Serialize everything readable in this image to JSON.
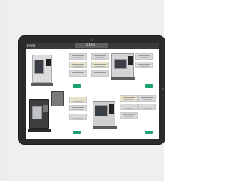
{
  "app": {
    "brand": "HAAS",
    "title": "DEMO"
  },
  "colors": {
    "page_background": "#efefef",
    "tablet_bezel": "#2b2b2b",
    "screen_background": "#ffffff",
    "header_bar": "#3a3a3a",
    "action_button": "#1aa36e"
  },
  "cards": [
    {
      "position": "top-left",
      "machine": "vertical-mill",
      "action_icon": "select-button"
    },
    {
      "position": "top-right",
      "machine": "enclosed-mill",
      "action_icon": "select-button"
    },
    {
      "position": "bottom-left",
      "machine": "vertical-mill-tall",
      "action_icon": "select-button"
    },
    {
      "position": "bottom-right",
      "machine": "lathe",
      "action_icon": "select-button"
    }
  ]
}
